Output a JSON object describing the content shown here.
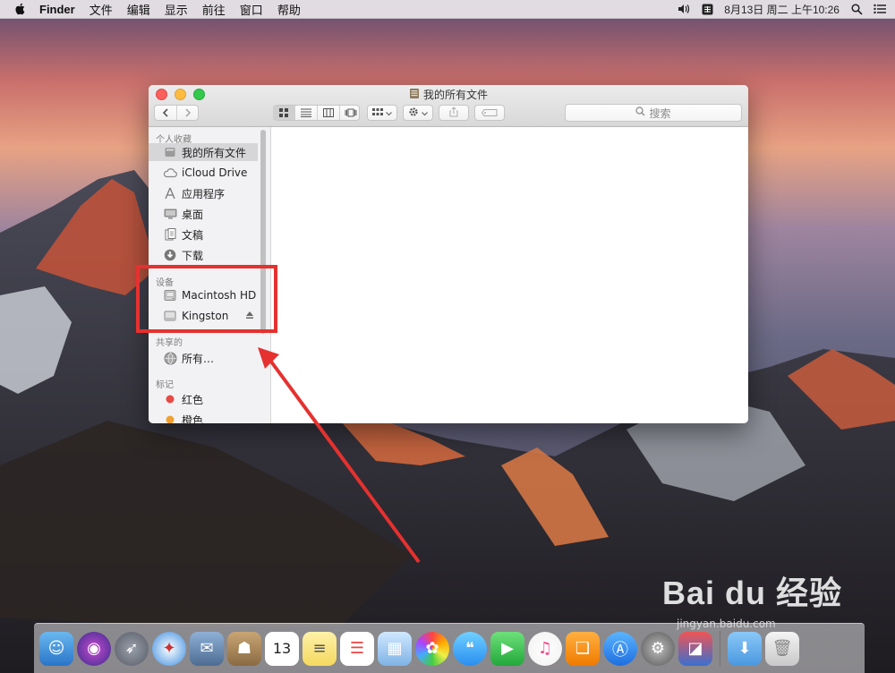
{
  "menubar": {
    "app": "Finder",
    "items": [
      "文件",
      "编辑",
      "显示",
      "前往",
      "窗口",
      "帮助"
    ],
    "datetime": "8月13日 周二 上午10:26"
  },
  "window": {
    "title": "我的所有文件",
    "search_placeholder": "搜索"
  },
  "sidebar": {
    "favorites_title": "个人收藏",
    "favorites": [
      {
        "label": "我的所有文件",
        "icon": "all-files-icon"
      },
      {
        "label": "iCloud Drive",
        "icon": "icloud-icon"
      },
      {
        "label": "应用程序",
        "icon": "applications-icon"
      },
      {
        "label": "桌面",
        "icon": "desktop-icon"
      },
      {
        "label": "文稿",
        "icon": "documents-icon"
      },
      {
        "label": "下载",
        "icon": "downloads-icon"
      }
    ],
    "devices_title": "设备",
    "devices": [
      {
        "label": "Macintosh HD",
        "icon": "hard-drive-icon"
      },
      {
        "label": "Kingston",
        "icon": "external-drive-icon"
      }
    ],
    "shared_title": "共享的",
    "shared": [
      {
        "label": "所有…",
        "icon": "network-icon"
      }
    ],
    "tags_title": "标记",
    "tags": [
      {
        "label": "红色",
        "color": "#e64a45"
      },
      {
        "label": "橙色",
        "color": "#f0a030"
      }
    ]
  },
  "watermark": {
    "brand": "Bai du 经验",
    "url": "jingyan.baidu.com"
  },
  "colors": {
    "highlight": "#e5312f",
    "selection": "#d6d6d8"
  }
}
